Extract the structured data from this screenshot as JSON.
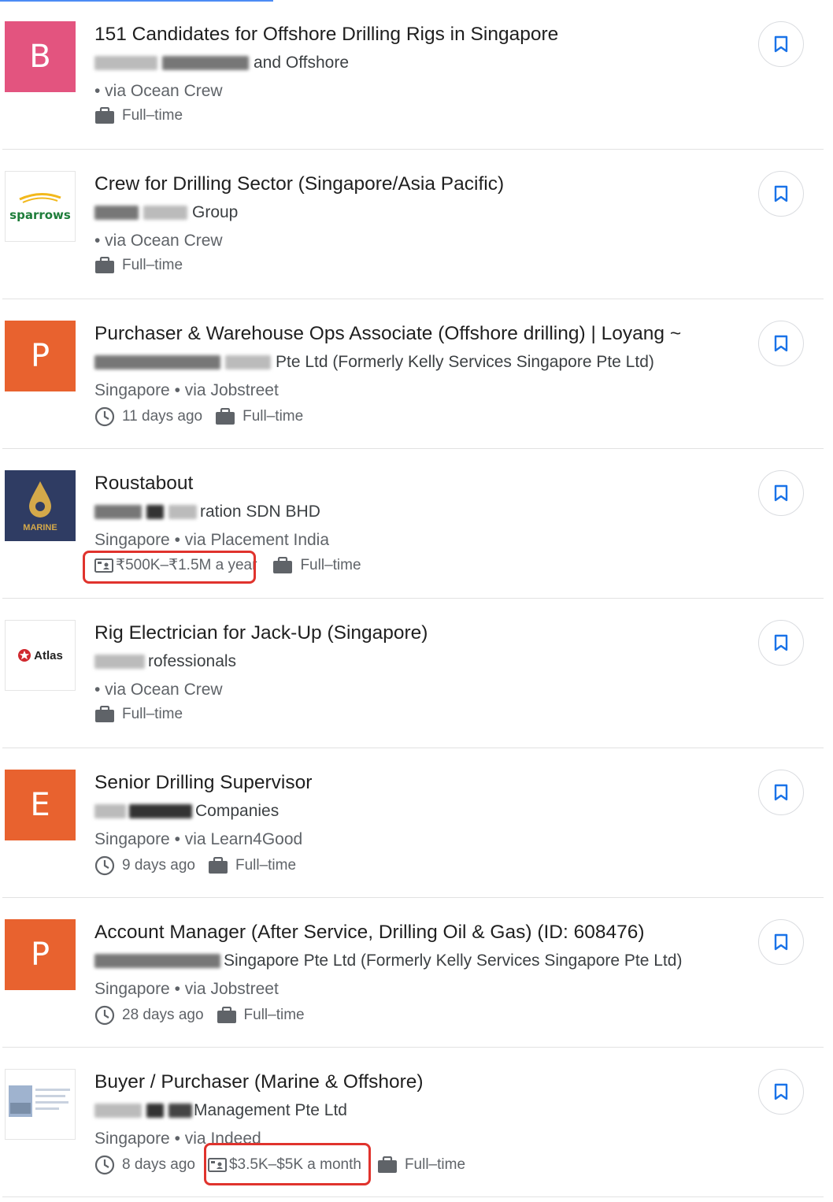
{
  "jobs": [
    {
      "logo_letter": "B",
      "logo_color": "#e3547f",
      "title": "151 Candidates for Offshore Drilling Rigs in Singapore",
      "company_visible": "and Offshore",
      "via": "• via Ocean Crew",
      "posted": "",
      "salary": "",
      "type": "Full–time"
    },
    {
      "logo_text": "sparrows",
      "title": "Crew for Drilling Sector (Singapore/Asia Pacific)",
      "company_visible": "Group",
      "via": "• via Ocean Crew",
      "posted": "",
      "salary": "",
      "type": "Full–time"
    },
    {
      "logo_letter": "P",
      "logo_color": "#e8622f",
      "title": "Purchaser & Warehouse Ops Associate (Offshore drilling) | Loyang ~",
      "company_visible": "Pte Ltd (Formerly Kelly Services Singapore Pte Ltd)",
      "via": "Singapore • via Jobstreet",
      "posted": "11 days ago",
      "salary": "",
      "type": "Full–time"
    },
    {
      "logo_text": "MARINE",
      "title": "Roustabout",
      "company_visible": "ration SDN BHD",
      "via": "Singapore • via Placement India",
      "posted": "",
      "salary": "₹500K–₹1.5M a year",
      "type": "Full–time"
    },
    {
      "logo_text": "Atlas",
      "title": "Rig Electrician for Jack-Up (Singapore)",
      "company_visible": "rofessionals",
      "via": "• via Ocean Crew",
      "posted": "",
      "salary": "",
      "type": "Full–time"
    },
    {
      "logo_letter": "E",
      "logo_color": "#e8622f",
      "title": "Senior Drilling Supervisor",
      "company_visible": "Companies",
      "via": "Singapore • via Learn4Good",
      "posted": "9 days ago",
      "salary": "",
      "type": "Full–time"
    },
    {
      "logo_letter": "P",
      "logo_color": "#e8622f",
      "title": "Account Manager (After Service, Drilling Oil & Gas) (ID: 608476)",
      "company_visible": "Singapore Pte Ltd (Formerly Kelly Services Singapore Pte Ltd)",
      "via": "Singapore • via Jobstreet",
      "posted": "28 days ago",
      "salary": "",
      "type": "Full–time"
    },
    {
      "logo_text": "",
      "title": "Buyer / Purchaser (Marine & Offshore)",
      "company_visible": "Management Pte Ltd",
      "via": "Singapore • via Indeed",
      "posted": "8 days ago",
      "salary": "$3.5K–$5K a month",
      "type": "Full–time"
    }
  ],
  "icons": {
    "bookmark": "bookmark-icon",
    "clock": "clock-icon",
    "briefcase": "briefcase-icon",
    "salary": "salary-icon"
  },
  "colors": {
    "accent": "#1a73e8",
    "highlight": "#e0332d"
  }
}
